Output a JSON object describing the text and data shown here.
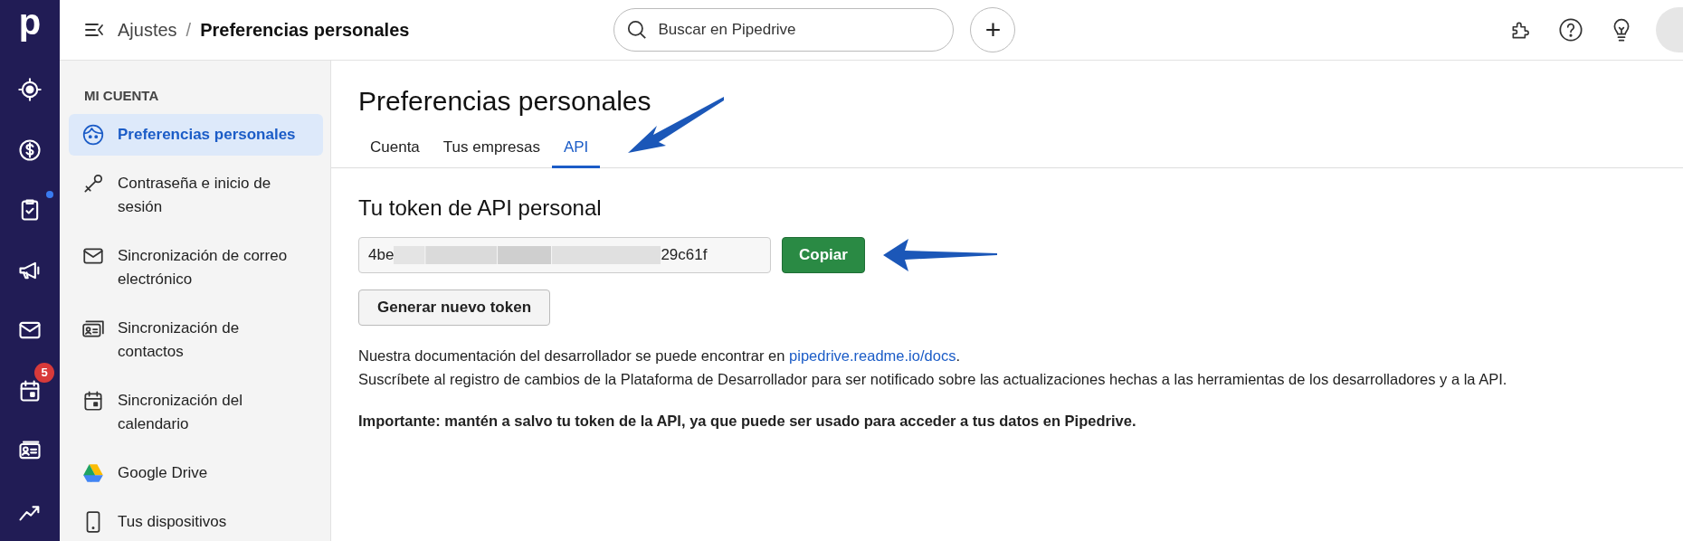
{
  "rail": {
    "logo": "p",
    "items": [
      {
        "kind": "target",
        "dot": false
      },
      {
        "kind": "dollar",
        "dot": false
      },
      {
        "kind": "clipboard",
        "dot": true
      },
      {
        "kind": "megaphone",
        "dot": false
      },
      {
        "kind": "mail",
        "dot": false
      },
      {
        "kind": "calendar",
        "dot": false,
        "badge": "5"
      },
      {
        "kind": "card",
        "dot": false
      },
      {
        "kind": "chart",
        "dot": false
      }
    ]
  },
  "topbar": {
    "breadcrumb": [
      "Ajustes",
      "Preferencias personales"
    ],
    "separator": "/",
    "search": {
      "placeholder": "Buscar en Pipedrive"
    },
    "add_button": "+",
    "icons": [
      {
        "kind": "puzzle"
      },
      {
        "kind": "help"
      },
      {
        "kind": "bulb"
      },
      {
        "kind": "avatar"
      }
    ]
  },
  "sidebar": {
    "section": "MI CUENTA",
    "items": [
      {
        "label": "Preferencias personales",
        "kind": "face",
        "selected": true
      },
      {
        "label": "Contraseña e inicio de sesión",
        "kind": "key",
        "selected": false
      },
      {
        "label": "Sincronización de correo electrónico",
        "kind": "mail",
        "selected": false
      },
      {
        "label": "Sincronización de contactos",
        "kind": "contacts",
        "selected": false
      },
      {
        "label": "Sincronización del calendario",
        "kind": "calendar",
        "selected": false
      },
      {
        "label": "Google Drive",
        "kind": "drive",
        "selected": false
      },
      {
        "label": "Tus dispositivos",
        "kind": "phone",
        "selected": false
      }
    ]
  },
  "main": {
    "title": "Preferencias personales",
    "tabs": [
      {
        "label": "Cuenta",
        "selected": false
      },
      {
        "label": "Tus empresas",
        "selected": false
      },
      {
        "label": "API",
        "selected": true
      }
    ],
    "heading": "Tu token de API personal",
    "token": {
      "start": "4be",
      "end": "29c61f"
    },
    "copy_button": "Copiar",
    "generate_button": "Generar nuevo token",
    "doc_text": "Nuestra documentación del desarrollador se puede encontrar en ",
    "doc_link": "pipedrive.readme.io/docs",
    "doc_end": ".",
    "changelog": "Suscríbete al registro de cambios de la Plataforma de Desarrollador para ser notificado sobre las actualizaciones hechas a las herramientas de los desarrolladores y a la API.",
    "warning": "Importante: mantén a salvo tu token de la API, ya que puede ser usado para acceder a tus datos en Pipedrive."
  },
  "annotations": [
    {
      "kind": "arrow"
    },
    {
      "kind": "arrow"
    }
  ]
}
